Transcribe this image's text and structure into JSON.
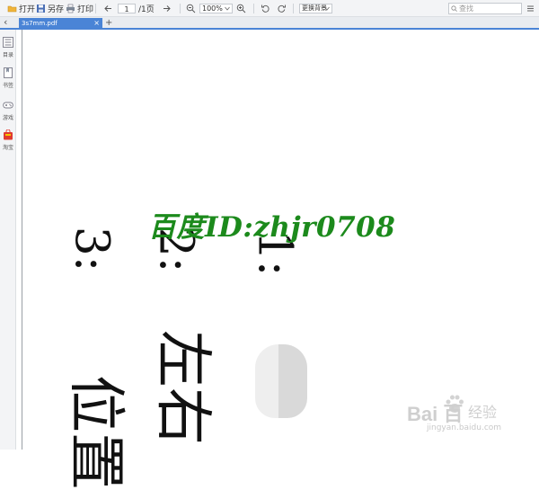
{
  "toolbar": {
    "open_label": "打开",
    "saveas_label": "另存",
    "print_label": "打印",
    "page_value": "1",
    "page_total": "/1页",
    "zoom_value": "100%",
    "bg_label": "更换背景",
    "search_placeholder": "查找"
  },
  "tabs": [
    {
      "label": "3s7mm.pdf",
      "close": "×"
    }
  ],
  "newtab_label": "+",
  "sidebar": {
    "collapse": "‹",
    "items": [
      {
        "label": "目录"
      },
      {
        "label": "书签"
      },
      {
        "label": "游戏"
      },
      {
        "label": "淘宝"
      }
    ]
  },
  "document": {
    "lines": [
      "1:",
      "2:",
      "3:",
      "左右",
      "位置"
    ],
    "watermark": "百度ID:zhjr0708"
  },
  "branding": {
    "logo": "Bai 百",
    "cn": "经验",
    "url": "jingyan.baidu.com"
  },
  "colors": {
    "accent": "#4a84d6",
    "watermark": "#1c8a1c",
    "taobao": "#e03a2f"
  }
}
